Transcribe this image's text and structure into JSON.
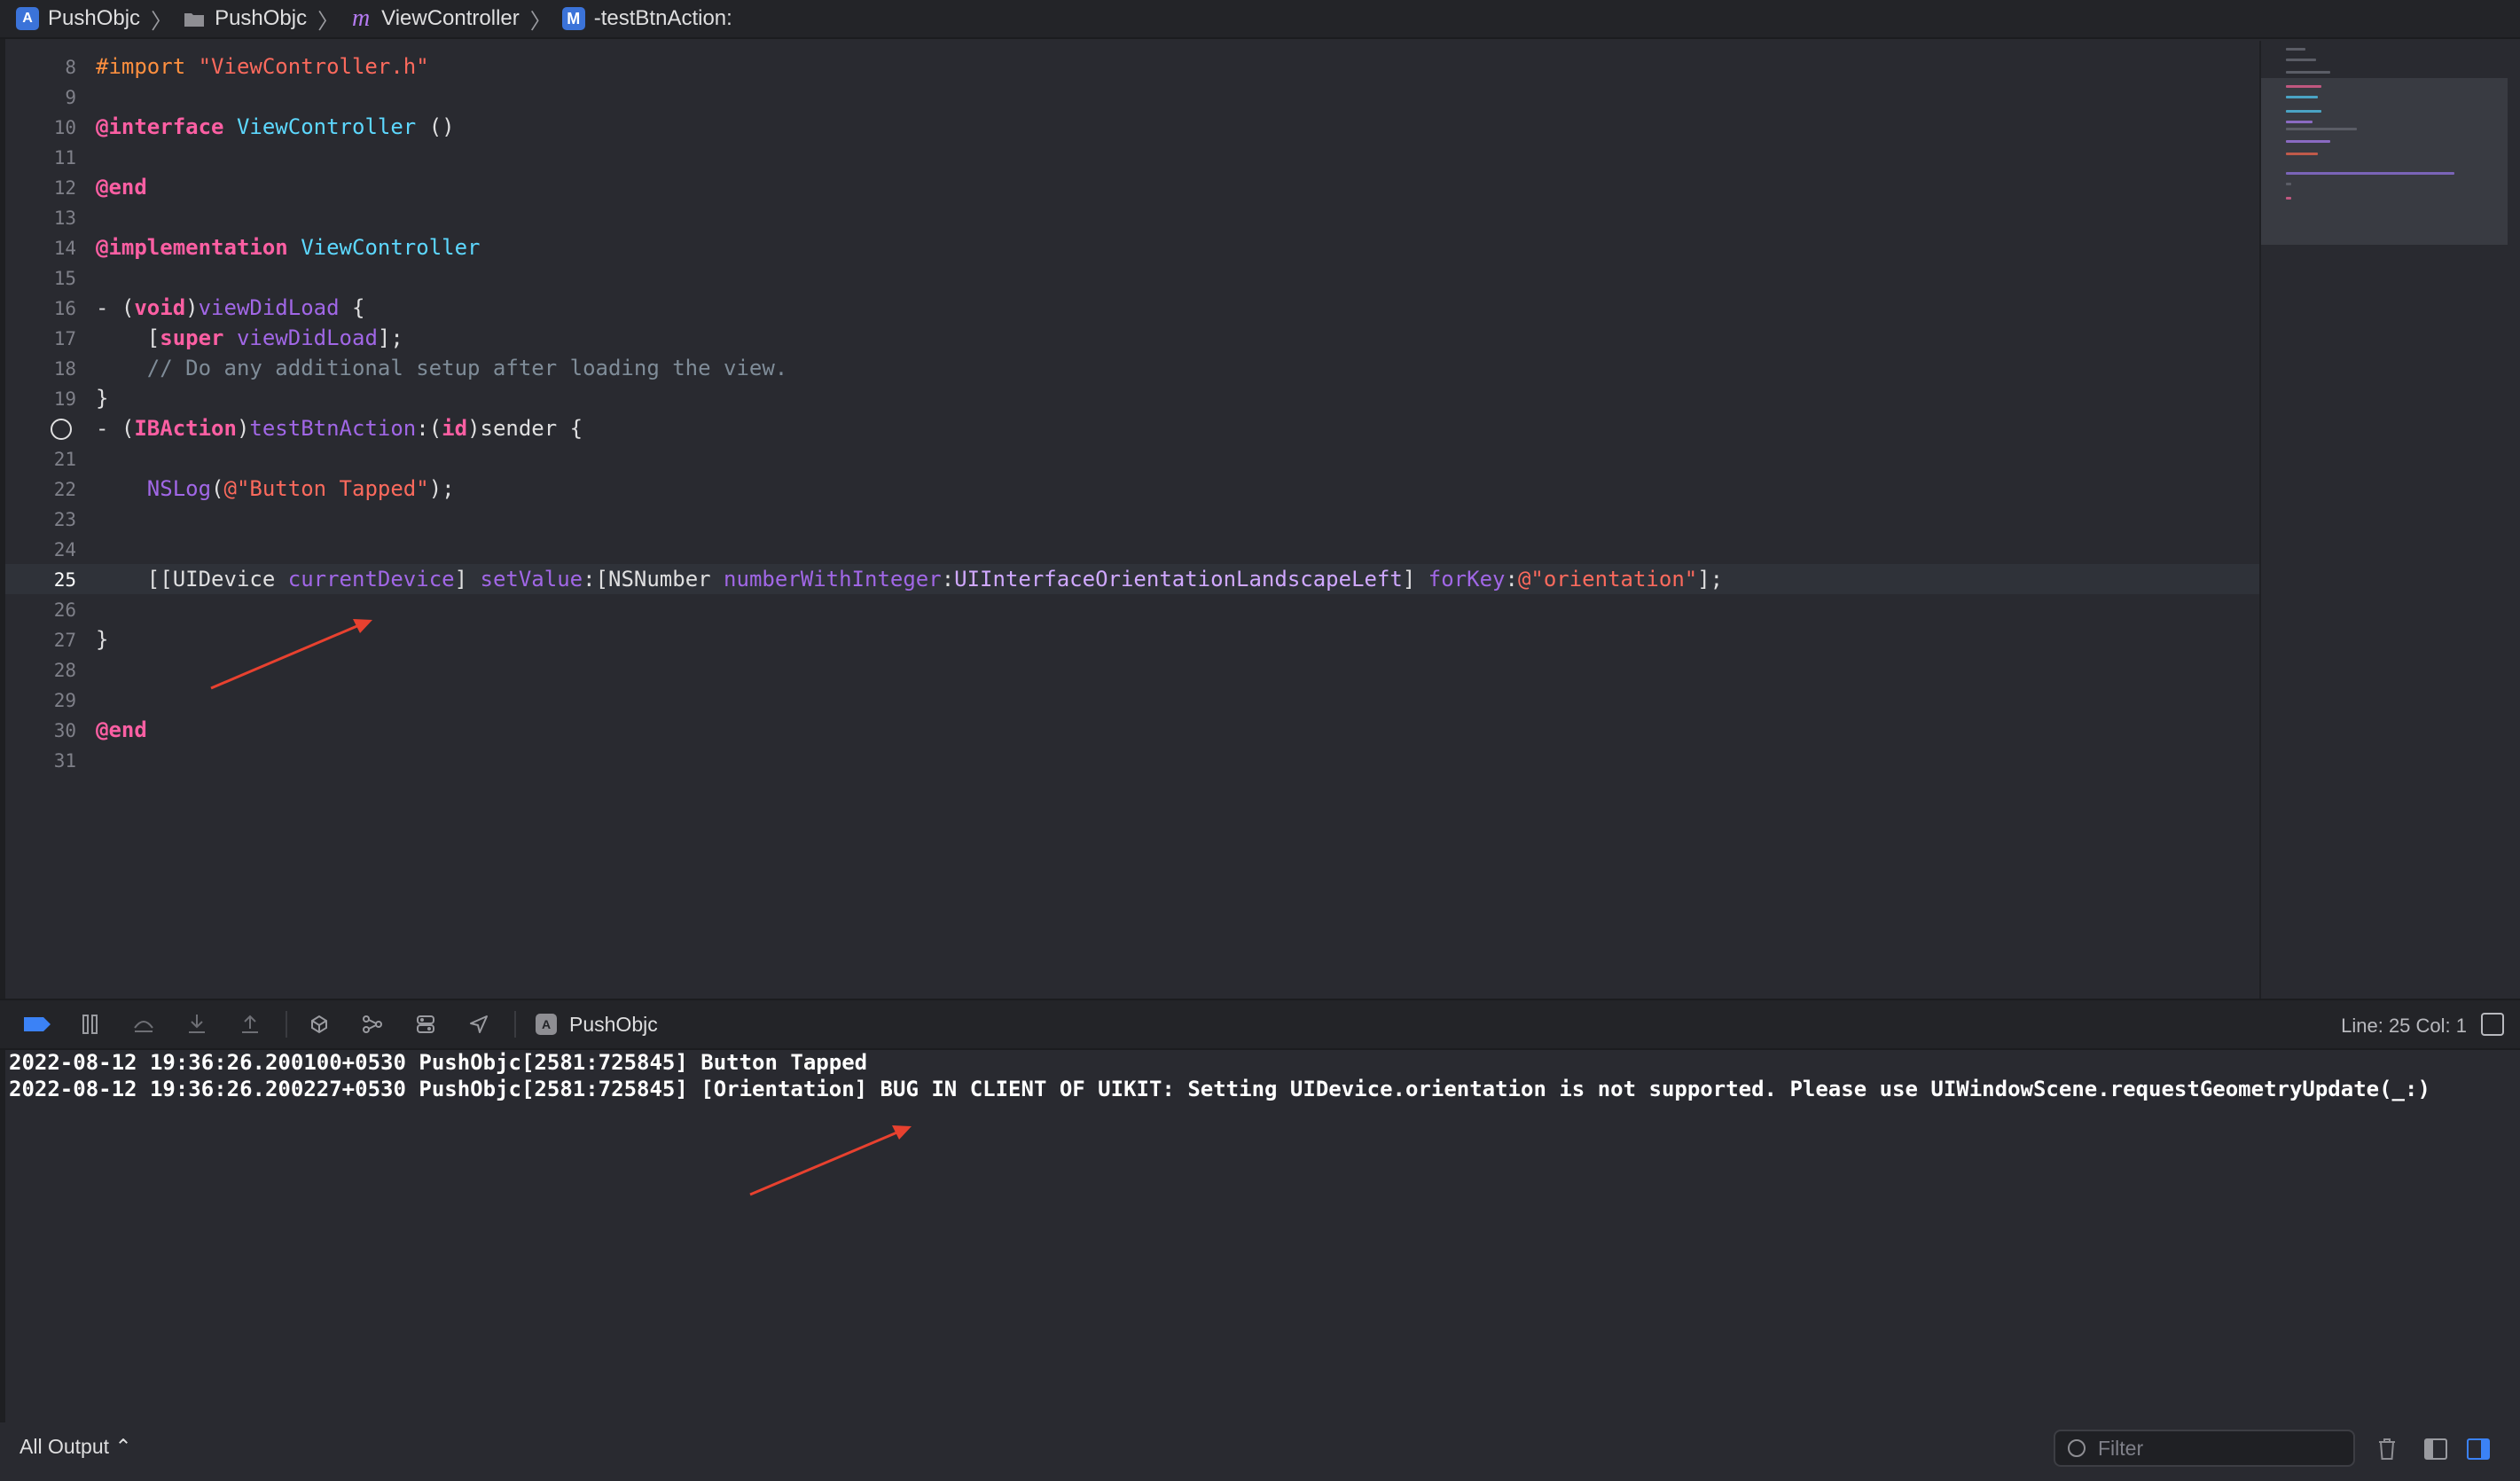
{
  "breadcrumb": {
    "items": [
      {
        "icon": "app-icon",
        "label": "PushObjc"
      },
      {
        "icon": "folder-icon",
        "label": "PushObjc"
      },
      {
        "icon": "objc-file-icon",
        "label": "ViewController"
      },
      {
        "icon": "method-icon",
        "label": "-testBtnAction:"
      }
    ],
    "app_badge": "A",
    "file_badge": "m",
    "method_badge": "M"
  },
  "editor": {
    "lines": [
      {
        "num": "8"
      },
      {
        "num": "9"
      },
      {
        "num": "10"
      },
      {
        "num": "11"
      },
      {
        "num": "12"
      },
      {
        "num": "13"
      },
      {
        "num": "14"
      },
      {
        "num": "15"
      },
      {
        "num": "16"
      },
      {
        "num": "17"
      },
      {
        "num": "18"
      },
      {
        "num": "19"
      },
      {
        "num": ""
      },
      {
        "num": "21"
      },
      {
        "num": "22"
      },
      {
        "num": "23"
      },
      {
        "num": "24"
      },
      {
        "num": "25"
      },
      {
        "num": "26"
      },
      {
        "num": "27"
      },
      {
        "num": "28"
      },
      {
        "num": "29"
      },
      {
        "num": "30"
      },
      {
        "num": "31"
      }
    ],
    "tokens": {
      "l8_a": "#import ",
      "l8_b": "\"ViewController.h\"",
      "l10_a": "@interface",
      "l10_b": " ",
      "l10_c": "ViewController",
      "l10_d": " ()",
      "l12_a": "@end",
      "l14_a": "@implementation",
      "l14_b": " ",
      "l14_c": "ViewController",
      "l16_a": "- (",
      "l16_b": "void",
      "l16_c": ")",
      "l16_d": "viewDidLoad",
      "l16_e": " {",
      "l17_a": "    [",
      "l17_b": "super",
      "l17_c": " ",
      "l17_d": "viewDidLoad",
      "l17_e": "];",
      "l18_a": "    // Do any additional setup after loading the view.",
      "l19_a": "}",
      "l20_a": "- (",
      "l20_b": "IBAction",
      "l20_c": ")",
      "l20_d": "testBtnAction",
      "l20_e": ":(",
      "l20_f": "id",
      "l20_g": ")sender {",
      "l22_a": "    ",
      "l22_b": "NSLog",
      "l22_c": "(",
      "l22_d": "@\"Button Tapped\"",
      "l22_e": ");",
      "l25_a": "    [[UIDevice ",
      "l25_b": "currentDevice",
      "l25_c": "] ",
      "l25_d": "setValue",
      "l25_e": ":[NSNumber ",
      "l25_f": "numberWithInteger",
      "l25_g": ":",
      "l25_h": "UIInterfaceOrientationLandscapeLeft",
      "l25_i": "] ",
      "l25_j": "forKey",
      "l25_k": ":",
      "l25_l": "@\"orientation\"",
      "l25_m": "];",
      "l27_a": "}",
      "l30_a": "@end"
    },
    "current_line": 25
  },
  "debug_bar": {
    "target_label": "PushObjc",
    "target_badge": "A",
    "line_col": "Line: 25  Col: 1",
    "buttons": [
      "breakpoints-toggle",
      "pause",
      "step-over",
      "step-into",
      "step-out",
      "view-hierarchy",
      "memory-graph",
      "environment-overrides",
      "simulate-location"
    ]
  },
  "console": {
    "lines": [
      "2022-08-12 19:36:26.200100+0530 PushObjc[2581:725845] Button Tapped",
      "2022-08-12 19:36:26.200227+0530 PushObjc[2581:725845] [Orientation] BUG IN CLIENT OF UIKIT: Setting UIDevice.orientation is not supported. Please use UIWindowScene.requestGeometryUpdate(_:)"
    ]
  },
  "bottom_bar": {
    "output_selector": "All Output ⌃",
    "filter_placeholder": "Filter"
  },
  "colors": {
    "annotation_arrow": "#e8412f",
    "accent": "#3b82f6"
  }
}
